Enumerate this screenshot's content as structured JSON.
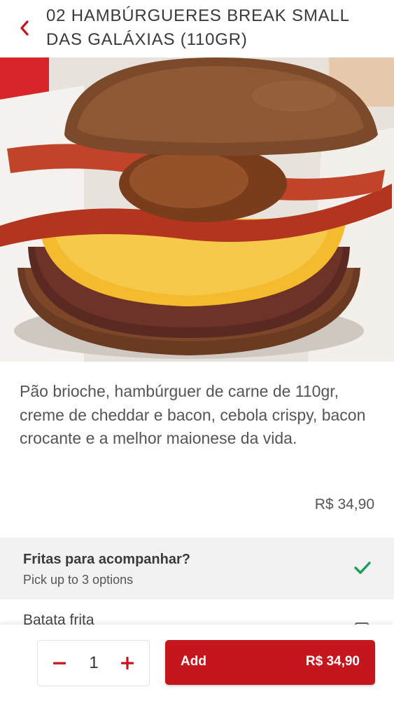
{
  "header": {
    "back_icon": "chevron-left-icon",
    "title_line1": "02 HAMBÚRGUERES BREAK SMALL",
    "title_line2": "DAS GALÁXIAS (110GR)"
  },
  "product": {
    "image": "burger-photo",
    "description": "Pão brioche, hambúrguer de carne de 110gr, creme de cheddar e bacon, cebola crispy, bacon crocante e a melhor maionese da vida.",
    "price": "R$ 34,90"
  },
  "options_section": {
    "title": "Fritas para acompanhar?",
    "subtitle": "Pick up to 3 options",
    "complete_icon": "checkmark-icon",
    "items": [
      {
        "label": "Batata frita",
        "checked": false
      }
    ]
  },
  "footer": {
    "quantity": "1",
    "minus_icon": "minus-icon",
    "plus_icon": "plus-icon",
    "add_label": "Add",
    "add_price": "R$ 34,90"
  },
  "colors": {
    "accent": "#c4161c",
    "check": "#1a9c5a"
  }
}
